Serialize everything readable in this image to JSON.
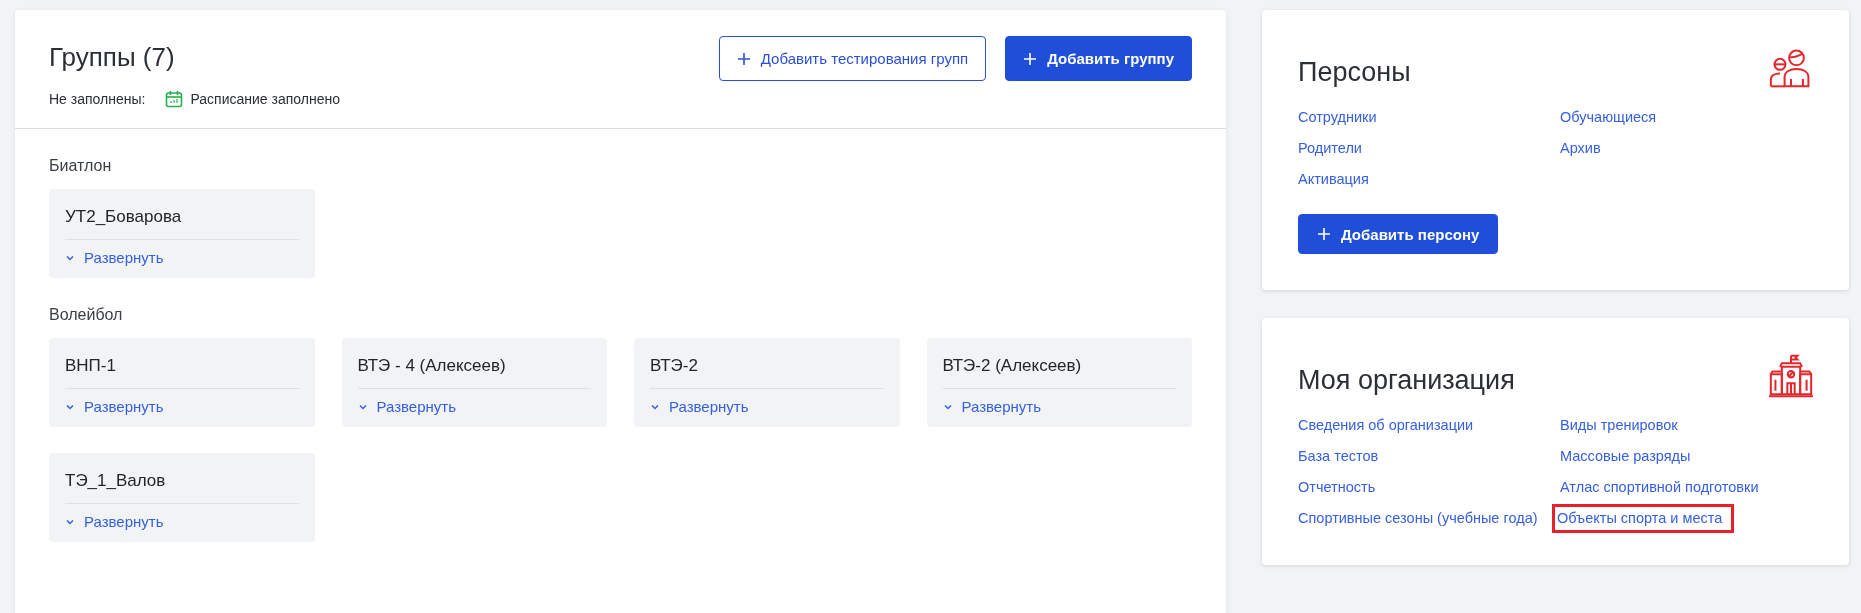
{
  "groups_panel": {
    "title": "Группы (7)",
    "buttons": [
      {
        "kind": "outline",
        "label": "Добавить тестирования групп"
      },
      {
        "kind": "primary",
        "label": "Добавить группу"
      }
    ],
    "missing_label": "Не заполнены:",
    "missing_items": [
      "Расписание заполнено"
    ],
    "sections": [
      {
        "title": "Биатлон",
        "groups": [
          {
            "name": "УТ2_Боварова",
            "expand": "Развернуть"
          }
        ]
      },
      {
        "title": "Волейбол",
        "groups": [
          {
            "name": "ВНП-1",
            "expand": "Развернуть"
          },
          {
            "name": "ВТЭ - 4 (Алексеев)",
            "expand": "Развернуть"
          },
          {
            "name": "ВТЭ-2",
            "expand": "Развернуть"
          },
          {
            "name": "ВТЭ-2 (Алексеев)",
            "expand": "Развернуть"
          },
          {
            "name": "ТЭ_1_Валов",
            "expand": "Развернуть"
          }
        ]
      }
    ]
  },
  "side_cards": [
    {
      "kind": "persons",
      "title": "Персоны",
      "links": [
        {
          "label": "Сотрудники",
          "highlighted": false
        },
        {
          "label": "Обучающиеся",
          "highlighted": false
        },
        {
          "label": "Родители",
          "highlighted": false
        },
        {
          "label": "Архив",
          "highlighted": false
        },
        {
          "label": "Активация",
          "highlighted": false
        }
      ],
      "button": "Добавить персону"
    },
    {
      "kind": "organization",
      "title": "Моя организация",
      "links": [
        {
          "label": "Сведения об организации",
          "highlighted": false
        },
        {
          "label": "Виды тренировок",
          "highlighted": false
        },
        {
          "label": "База тестов",
          "highlighted": false
        },
        {
          "label": "Массовые разряды",
          "highlighted": false
        },
        {
          "label": "Отчетность",
          "highlighted": false
        },
        {
          "label": "Атлас спортивной подготовки",
          "highlighted": false
        },
        {
          "label": "Спортивные сезоны (учебные года)",
          "highlighted": false
        },
        {
          "label": "Объекты спорта и места",
          "highlighted": true
        }
      ]
    }
  ]
}
